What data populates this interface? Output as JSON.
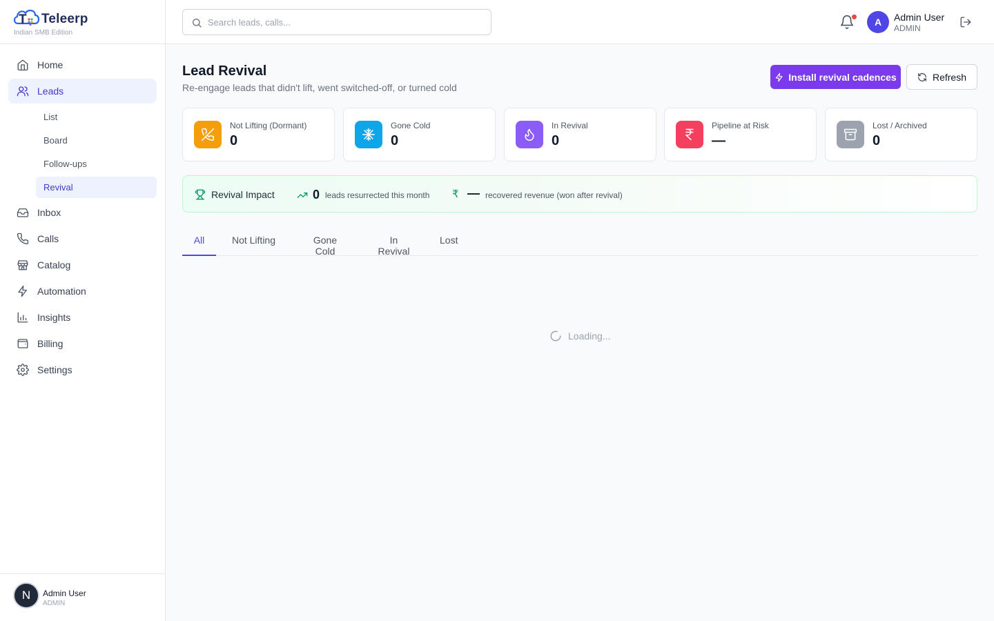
{
  "brand": {
    "name": "Teleerp",
    "edition": "Indian SMB Edition"
  },
  "sidebar": {
    "items": [
      {
        "label": "Home",
        "icon": "home-icon"
      },
      {
        "label": "Leads",
        "icon": "users-icon",
        "active": true
      },
      {
        "label": "Inbox",
        "icon": "inbox-icon"
      },
      {
        "label": "Calls",
        "icon": "phone-icon"
      },
      {
        "label": "Catalog",
        "icon": "store-icon"
      },
      {
        "label": "Automation",
        "icon": "zap-icon"
      },
      {
        "label": "Insights",
        "icon": "bar-chart-icon"
      },
      {
        "label": "Billing",
        "icon": "wallet-icon"
      },
      {
        "label": "Settings",
        "icon": "gear-icon"
      }
    ],
    "leads_sub": [
      {
        "label": "List"
      },
      {
        "label": "Board"
      },
      {
        "label": "Follow-ups"
      },
      {
        "label": "Revival",
        "active": true
      }
    ],
    "footer": {
      "initial": "N",
      "name": "Admin User",
      "role": "ADMIN"
    }
  },
  "topbar": {
    "search_placeholder": "Search leads, calls...",
    "user_initial": "A",
    "user_name": "Admin User",
    "user_role": "ADMIN"
  },
  "page": {
    "title": "Lead Revival",
    "subtitle": "Re-engage leads that didn't lift, went switched-off, or turned cold",
    "primary_button": "Install revival cadences",
    "secondary_button": "Refresh"
  },
  "stats": [
    {
      "label": "Not Lifting (Dormant)",
      "value": "0",
      "icon": "phone-off-icon",
      "color": "#f59e0b"
    },
    {
      "label": "Gone Cold",
      "value": "0",
      "icon": "snowflake-icon",
      "color": "#0ea5e9"
    },
    {
      "label": "In Revival",
      "value": "0",
      "icon": "flame-icon",
      "color": "#8b5cf6"
    },
    {
      "label": "Pipeline at Risk",
      "value": "—",
      "icon": "rupee-icon",
      "color": "#f43f5e"
    },
    {
      "label": "Lost / Archived",
      "value": "0",
      "icon": "archive-icon",
      "color": "#9ca3af"
    }
  ],
  "impact": {
    "title": "Revival Impact",
    "resurrected_count": "0",
    "resurrected_label": "leads resurrected this month",
    "currency_symbol": "₹",
    "recovered_value": "—",
    "recovered_label": "recovered revenue (won after revival)"
  },
  "tabs": [
    {
      "label": "All",
      "active": true
    },
    {
      "label": "Not Lifting"
    },
    {
      "label": "Gone Cold"
    },
    {
      "label": "In Revival"
    },
    {
      "label": "Lost"
    }
  ],
  "loading_text": "Loading...",
  "colors": {
    "accent": "#4f46e5",
    "primary_button": "#7c3aed",
    "success": "#059669",
    "notification": "#ef4444"
  }
}
